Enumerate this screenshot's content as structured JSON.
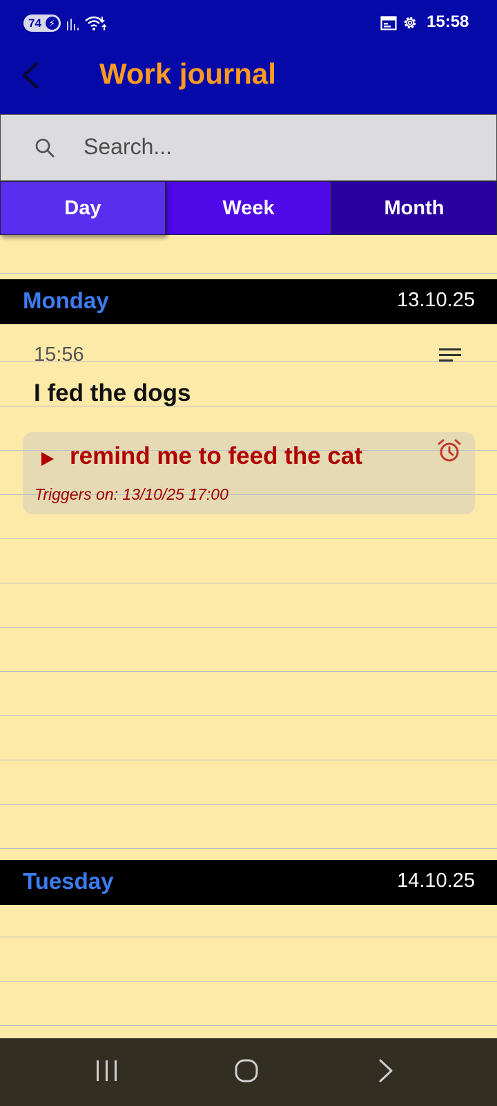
{
  "status_bar": {
    "battery_level": "74",
    "battery_charging_icon": "bolt-icon",
    "time": "15:58",
    "icons": [
      "signal-icon",
      "wifi-icon",
      "calendar-icon",
      "settings-icon"
    ]
  },
  "app_bar": {
    "title": "Work journal",
    "back_icon": "back-arrow-icon"
  },
  "search": {
    "placeholder": "Search...",
    "value": ""
  },
  "tabs": [
    {
      "label": "Day",
      "selected": true
    },
    {
      "label": "Week",
      "selected": false
    },
    {
      "label": "Month",
      "selected": false
    }
  ],
  "days": [
    {
      "name": "Monday",
      "date": "13.10.25",
      "entries": [
        {
          "time": "15:56",
          "text": "I fed the dogs",
          "reminder": {
            "text": "remind me to feed the cat",
            "trigger": "Triggers on: 13/10/25 17:00"
          }
        }
      ]
    },
    {
      "name": "Tuesday",
      "date": "14.10.25",
      "entries": []
    }
  ],
  "colors": {
    "app_bar": "#0409A8",
    "title": "#FF9A1F",
    "paper": "#FEEAA8",
    "day_name": "#3D7CF0",
    "reminder": "#B00000",
    "tab_day": "#5A2EEE",
    "tab_week": "#4F08E8",
    "tab_month": "#2A00A0"
  }
}
